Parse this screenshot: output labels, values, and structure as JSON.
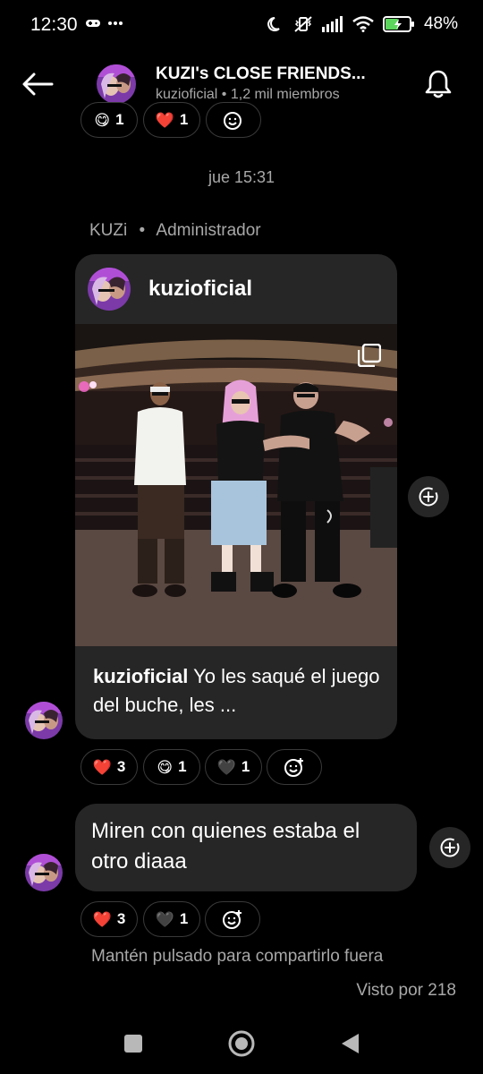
{
  "status_bar": {
    "time": "12:30",
    "battery": "48%",
    "icons": [
      "gamepad-icon",
      "more-dots-icon",
      "moon-icon",
      "vibrate-off-icon",
      "signal-icon",
      "wifi-icon",
      "battery-charging-icon"
    ]
  },
  "header": {
    "title": "KUZI's CLOSE FRIENDS...",
    "subtitle": "kuzioficial • 1,2 mil miembros"
  },
  "top_reactions": [
    {
      "emoji": "😋",
      "count": "1"
    },
    {
      "emoji": "❤️",
      "count": "1"
    }
  ],
  "timestamp": "jue 15:31",
  "sender": {
    "name": "KUZi",
    "separator": "•",
    "role": "Administrador"
  },
  "post": {
    "username": "kuzioficial",
    "caption_user": "kuzioficial",
    "caption_text": " Yo les saqué el juego del buche, les ..."
  },
  "post_reactions": [
    {
      "emoji": "❤️",
      "count": "3"
    },
    {
      "emoji": "😋",
      "count": "1"
    },
    {
      "emoji": "🖤",
      "count": "1"
    }
  ],
  "message": {
    "text": "Miren con quienes estaba el otro diaaa"
  },
  "message_reactions": [
    {
      "emoji": "❤️",
      "count": "3"
    },
    {
      "emoji": "🖤",
      "count": "1"
    }
  ],
  "hint": "Mantén pulsado para compartirlo fuera",
  "seen": "Visto por 218",
  "colors": {
    "background": "#000000",
    "bubble": "#262626",
    "secondary_text": "#a8a8a8",
    "heart": "#ff3040"
  }
}
